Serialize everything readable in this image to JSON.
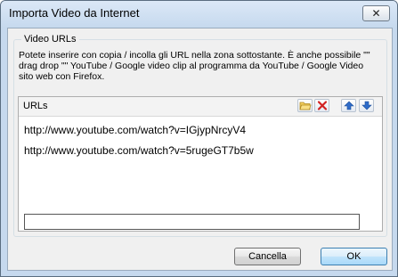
{
  "window": {
    "title": "Importa Video da Internet",
    "close_glyph": "✕"
  },
  "group": {
    "legend": "Video URLs",
    "description_lines": [
      "Potete inserire con copia / incolla gli URL nella zona sottostante. È anche possibile \"\"",
      " drag  drop \"\" YouTube / Google video clip al programma da YouTube / Google Video",
      "sito web con Firefox."
    ]
  },
  "urls": {
    "header": "URLs",
    "toolbar": {
      "icons": [
        "open-folder-icon",
        "delete-icon",
        "move-up-icon",
        "move-down-icon"
      ]
    },
    "items": [
      "http://www.youtube.com/watch?v=IGjypNrcyV4",
      "http://www.youtube.com/watch?v=5rugeGT7b5w"
    ],
    "new_url_value": ""
  },
  "buttons": {
    "cancel": "Cancella",
    "ok": "OK"
  }
}
